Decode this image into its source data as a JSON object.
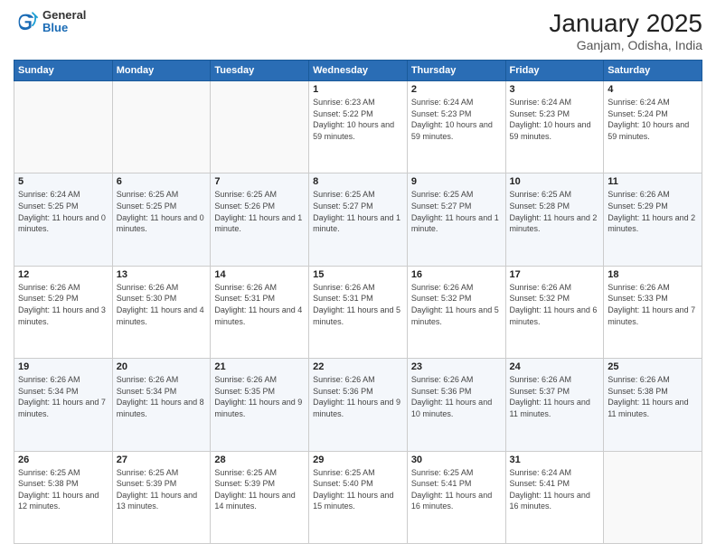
{
  "logo": {
    "line1": "General",
    "line2": "Blue"
  },
  "title": {
    "month_year": "January 2025",
    "location": "Ganjam, Odisha, India"
  },
  "weekdays": [
    "Sunday",
    "Monday",
    "Tuesday",
    "Wednesday",
    "Thursday",
    "Friday",
    "Saturday"
  ],
  "weeks": [
    [
      {
        "day": "",
        "sunrise": "",
        "sunset": "",
        "daylight": ""
      },
      {
        "day": "",
        "sunrise": "",
        "sunset": "",
        "daylight": ""
      },
      {
        "day": "",
        "sunrise": "",
        "sunset": "",
        "daylight": ""
      },
      {
        "day": "1",
        "sunrise": "Sunrise: 6:23 AM",
        "sunset": "Sunset: 5:22 PM",
        "daylight": "Daylight: 10 hours and 59 minutes."
      },
      {
        "day": "2",
        "sunrise": "Sunrise: 6:24 AM",
        "sunset": "Sunset: 5:23 PM",
        "daylight": "Daylight: 10 hours and 59 minutes."
      },
      {
        "day": "3",
        "sunrise": "Sunrise: 6:24 AM",
        "sunset": "Sunset: 5:23 PM",
        "daylight": "Daylight: 10 hours and 59 minutes."
      },
      {
        "day": "4",
        "sunrise": "Sunrise: 6:24 AM",
        "sunset": "Sunset: 5:24 PM",
        "daylight": "Daylight: 10 hours and 59 minutes."
      }
    ],
    [
      {
        "day": "5",
        "sunrise": "Sunrise: 6:24 AM",
        "sunset": "Sunset: 5:25 PM",
        "daylight": "Daylight: 11 hours and 0 minutes."
      },
      {
        "day": "6",
        "sunrise": "Sunrise: 6:25 AM",
        "sunset": "Sunset: 5:25 PM",
        "daylight": "Daylight: 11 hours and 0 minutes."
      },
      {
        "day": "7",
        "sunrise": "Sunrise: 6:25 AM",
        "sunset": "Sunset: 5:26 PM",
        "daylight": "Daylight: 11 hours and 1 minute."
      },
      {
        "day": "8",
        "sunrise": "Sunrise: 6:25 AM",
        "sunset": "Sunset: 5:27 PM",
        "daylight": "Daylight: 11 hours and 1 minute."
      },
      {
        "day": "9",
        "sunrise": "Sunrise: 6:25 AM",
        "sunset": "Sunset: 5:27 PM",
        "daylight": "Daylight: 11 hours and 1 minute."
      },
      {
        "day": "10",
        "sunrise": "Sunrise: 6:25 AM",
        "sunset": "Sunset: 5:28 PM",
        "daylight": "Daylight: 11 hours and 2 minutes."
      },
      {
        "day": "11",
        "sunrise": "Sunrise: 6:26 AM",
        "sunset": "Sunset: 5:29 PM",
        "daylight": "Daylight: 11 hours and 2 minutes."
      }
    ],
    [
      {
        "day": "12",
        "sunrise": "Sunrise: 6:26 AM",
        "sunset": "Sunset: 5:29 PM",
        "daylight": "Daylight: 11 hours and 3 minutes."
      },
      {
        "day": "13",
        "sunrise": "Sunrise: 6:26 AM",
        "sunset": "Sunset: 5:30 PM",
        "daylight": "Daylight: 11 hours and 4 minutes."
      },
      {
        "day": "14",
        "sunrise": "Sunrise: 6:26 AM",
        "sunset": "Sunset: 5:31 PM",
        "daylight": "Daylight: 11 hours and 4 minutes."
      },
      {
        "day": "15",
        "sunrise": "Sunrise: 6:26 AM",
        "sunset": "Sunset: 5:31 PM",
        "daylight": "Daylight: 11 hours and 5 minutes."
      },
      {
        "day": "16",
        "sunrise": "Sunrise: 6:26 AM",
        "sunset": "Sunset: 5:32 PM",
        "daylight": "Daylight: 11 hours and 5 minutes."
      },
      {
        "day": "17",
        "sunrise": "Sunrise: 6:26 AM",
        "sunset": "Sunset: 5:32 PM",
        "daylight": "Daylight: 11 hours and 6 minutes."
      },
      {
        "day": "18",
        "sunrise": "Sunrise: 6:26 AM",
        "sunset": "Sunset: 5:33 PM",
        "daylight": "Daylight: 11 hours and 7 minutes."
      }
    ],
    [
      {
        "day": "19",
        "sunrise": "Sunrise: 6:26 AM",
        "sunset": "Sunset: 5:34 PM",
        "daylight": "Daylight: 11 hours and 7 minutes."
      },
      {
        "day": "20",
        "sunrise": "Sunrise: 6:26 AM",
        "sunset": "Sunset: 5:34 PM",
        "daylight": "Daylight: 11 hours and 8 minutes."
      },
      {
        "day": "21",
        "sunrise": "Sunrise: 6:26 AM",
        "sunset": "Sunset: 5:35 PM",
        "daylight": "Daylight: 11 hours and 9 minutes."
      },
      {
        "day": "22",
        "sunrise": "Sunrise: 6:26 AM",
        "sunset": "Sunset: 5:36 PM",
        "daylight": "Daylight: 11 hours and 9 minutes."
      },
      {
        "day": "23",
        "sunrise": "Sunrise: 6:26 AM",
        "sunset": "Sunset: 5:36 PM",
        "daylight": "Daylight: 11 hours and 10 minutes."
      },
      {
        "day": "24",
        "sunrise": "Sunrise: 6:26 AM",
        "sunset": "Sunset: 5:37 PM",
        "daylight": "Daylight: 11 hours and 11 minutes."
      },
      {
        "day": "25",
        "sunrise": "Sunrise: 6:26 AM",
        "sunset": "Sunset: 5:38 PM",
        "daylight": "Daylight: 11 hours and 11 minutes."
      }
    ],
    [
      {
        "day": "26",
        "sunrise": "Sunrise: 6:25 AM",
        "sunset": "Sunset: 5:38 PM",
        "daylight": "Daylight: 11 hours and 12 minutes."
      },
      {
        "day": "27",
        "sunrise": "Sunrise: 6:25 AM",
        "sunset": "Sunset: 5:39 PM",
        "daylight": "Daylight: 11 hours and 13 minutes."
      },
      {
        "day": "28",
        "sunrise": "Sunrise: 6:25 AM",
        "sunset": "Sunset: 5:39 PM",
        "daylight": "Daylight: 11 hours and 14 minutes."
      },
      {
        "day": "29",
        "sunrise": "Sunrise: 6:25 AM",
        "sunset": "Sunset: 5:40 PM",
        "daylight": "Daylight: 11 hours and 15 minutes."
      },
      {
        "day": "30",
        "sunrise": "Sunrise: 6:25 AM",
        "sunset": "Sunset: 5:41 PM",
        "daylight": "Daylight: 11 hours and 16 minutes."
      },
      {
        "day": "31",
        "sunrise": "Sunrise: 6:24 AM",
        "sunset": "Sunset: 5:41 PM",
        "daylight": "Daylight: 11 hours and 16 minutes."
      },
      {
        "day": "",
        "sunrise": "",
        "sunset": "",
        "daylight": ""
      }
    ]
  ]
}
